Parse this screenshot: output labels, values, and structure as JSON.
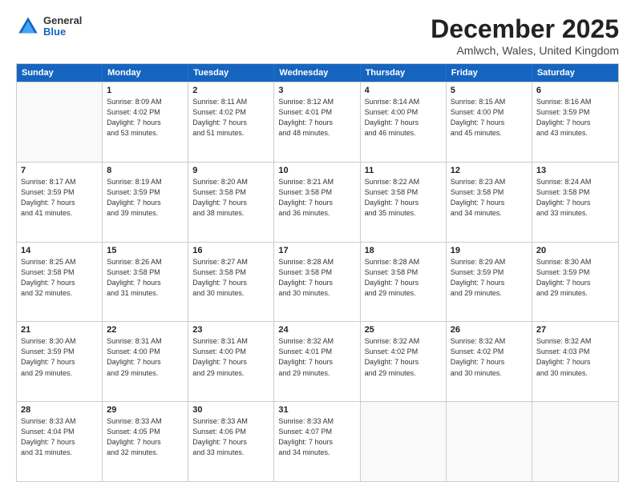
{
  "header": {
    "logo_general": "General",
    "logo_blue": "Blue",
    "month_title": "December 2025",
    "location": "Amlwch, Wales, United Kingdom"
  },
  "weekdays": [
    "Sunday",
    "Monday",
    "Tuesday",
    "Wednesday",
    "Thursday",
    "Friday",
    "Saturday"
  ],
  "weeks": [
    [
      {
        "day": "",
        "sunrise": "",
        "sunset": "",
        "daylight": ""
      },
      {
        "day": "1",
        "sunrise": "Sunrise: 8:09 AM",
        "sunset": "Sunset: 4:02 PM",
        "daylight": "Daylight: 7 hours",
        "daylight2": "and 53 minutes."
      },
      {
        "day": "2",
        "sunrise": "Sunrise: 8:11 AM",
        "sunset": "Sunset: 4:02 PM",
        "daylight": "Daylight: 7 hours",
        "daylight2": "and 51 minutes."
      },
      {
        "day": "3",
        "sunrise": "Sunrise: 8:12 AM",
        "sunset": "Sunset: 4:01 PM",
        "daylight": "Daylight: 7 hours",
        "daylight2": "and 48 minutes."
      },
      {
        "day": "4",
        "sunrise": "Sunrise: 8:14 AM",
        "sunset": "Sunset: 4:00 PM",
        "daylight": "Daylight: 7 hours",
        "daylight2": "and 46 minutes."
      },
      {
        "day": "5",
        "sunrise": "Sunrise: 8:15 AM",
        "sunset": "Sunset: 4:00 PM",
        "daylight": "Daylight: 7 hours",
        "daylight2": "and 45 minutes."
      },
      {
        "day": "6",
        "sunrise": "Sunrise: 8:16 AM",
        "sunset": "Sunset: 3:59 PM",
        "daylight": "Daylight: 7 hours",
        "daylight2": "and 43 minutes."
      }
    ],
    [
      {
        "day": "7",
        "sunrise": "Sunrise: 8:17 AM",
        "sunset": "Sunset: 3:59 PM",
        "daylight": "Daylight: 7 hours",
        "daylight2": "and 41 minutes."
      },
      {
        "day": "8",
        "sunrise": "Sunrise: 8:19 AM",
        "sunset": "Sunset: 3:59 PM",
        "daylight": "Daylight: 7 hours",
        "daylight2": "and 39 minutes."
      },
      {
        "day": "9",
        "sunrise": "Sunrise: 8:20 AM",
        "sunset": "Sunset: 3:58 PM",
        "daylight": "Daylight: 7 hours",
        "daylight2": "and 38 minutes."
      },
      {
        "day": "10",
        "sunrise": "Sunrise: 8:21 AM",
        "sunset": "Sunset: 3:58 PM",
        "daylight": "Daylight: 7 hours",
        "daylight2": "and 36 minutes."
      },
      {
        "day": "11",
        "sunrise": "Sunrise: 8:22 AM",
        "sunset": "Sunset: 3:58 PM",
        "daylight": "Daylight: 7 hours",
        "daylight2": "and 35 minutes."
      },
      {
        "day": "12",
        "sunrise": "Sunrise: 8:23 AM",
        "sunset": "Sunset: 3:58 PM",
        "daylight": "Daylight: 7 hours",
        "daylight2": "and 34 minutes."
      },
      {
        "day": "13",
        "sunrise": "Sunrise: 8:24 AM",
        "sunset": "Sunset: 3:58 PM",
        "daylight": "Daylight: 7 hours",
        "daylight2": "and 33 minutes."
      }
    ],
    [
      {
        "day": "14",
        "sunrise": "Sunrise: 8:25 AM",
        "sunset": "Sunset: 3:58 PM",
        "daylight": "Daylight: 7 hours",
        "daylight2": "and 32 minutes."
      },
      {
        "day": "15",
        "sunrise": "Sunrise: 8:26 AM",
        "sunset": "Sunset: 3:58 PM",
        "daylight": "Daylight: 7 hours",
        "daylight2": "and 31 minutes."
      },
      {
        "day": "16",
        "sunrise": "Sunrise: 8:27 AM",
        "sunset": "Sunset: 3:58 PM",
        "daylight": "Daylight: 7 hours",
        "daylight2": "and 30 minutes."
      },
      {
        "day": "17",
        "sunrise": "Sunrise: 8:28 AM",
        "sunset": "Sunset: 3:58 PM",
        "daylight": "Daylight: 7 hours",
        "daylight2": "and 30 minutes."
      },
      {
        "day": "18",
        "sunrise": "Sunrise: 8:28 AM",
        "sunset": "Sunset: 3:58 PM",
        "daylight": "Daylight: 7 hours",
        "daylight2": "and 29 minutes."
      },
      {
        "day": "19",
        "sunrise": "Sunrise: 8:29 AM",
        "sunset": "Sunset: 3:59 PM",
        "daylight": "Daylight: 7 hours",
        "daylight2": "and 29 minutes."
      },
      {
        "day": "20",
        "sunrise": "Sunrise: 8:30 AM",
        "sunset": "Sunset: 3:59 PM",
        "daylight": "Daylight: 7 hours",
        "daylight2": "and 29 minutes."
      }
    ],
    [
      {
        "day": "21",
        "sunrise": "Sunrise: 8:30 AM",
        "sunset": "Sunset: 3:59 PM",
        "daylight": "Daylight: 7 hours",
        "daylight2": "and 29 minutes."
      },
      {
        "day": "22",
        "sunrise": "Sunrise: 8:31 AM",
        "sunset": "Sunset: 4:00 PM",
        "daylight": "Daylight: 7 hours",
        "daylight2": "and 29 minutes."
      },
      {
        "day": "23",
        "sunrise": "Sunrise: 8:31 AM",
        "sunset": "Sunset: 4:00 PM",
        "daylight": "Daylight: 7 hours",
        "daylight2": "and 29 minutes."
      },
      {
        "day": "24",
        "sunrise": "Sunrise: 8:32 AM",
        "sunset": "Sunset: 4:01 PM",
        "daylight": "Daylight: 7 hours",
        "daylight2": "and 29 minutes."
      },
      {
        "day": "25",
        "sunrise": "Sunrise: 8:32 AM",
        "sunset": "Sunset: 4:02 PM",
        "daylight": "Daylight: 7 hours",
        "daylight2": "and 29 minutes."
      },
      {
        "day": "26",
        "sunrise": "Sunrise: 8:32 AM",
        "sunset": "Sunset: 4:02 PM",
        "daylight": "Daylight: 7 hours",
        "daylight2": "and 30 minutes."
      },
      {
        "day": "27",
        "sunrise": "Sunrise: 8:32 AM",
        "sunset": "Sunset: 4:03 PM",
        "daylight": "Daylight: 7 hours",
        "daylight2": "and 30 minutes."
      }
    ],
    [
      {
        "day": "28",
        "sunrise": "Sunrise: 8:33 AM",
        "sunset": "Sunset: 4:04 PM",
        "daylight": "Daylight: 7 hours",
        "daylight2": "and 31 minutes."
      },
      {
        "day": "29",
        "sunrise": "Sunrise: 8:33 AM",
        "sunset": "Sunset: 4:05 PM",
        "daylight": "Daylight: 7 hours",
        "daylight2": "and 32 minutes."
      },
      {
        "day": "30",
        "sunrise": "Sunrise: 8:33 AM",
        "sunset": "Sunset: 4:06 PM",
        "daylight": "Daylight: 7 hours",
        "daylight2": "and 33 minutes."
      },
      {
        "day": "31",
        "sunrise": "Sunrise: 8:33 AM",
        "sunset": "Sunset: 4:07 PM",
        "daylight": "Daylight: 7 hours",
        "daylight2": "and 34 minutes."
      },
      {
        "day": "",
        "sunrise": "",
        "sunset": "",
        "daylight": ""
      },
      {
        "day": "",
        "sunrise": "",
        "sunset": "",
        "daylight": ""
      },
      {
        "day": "",
        "sunrise": "",
        "sunset": "",
        "daylight": ""
      }
    ]
  ]
}
